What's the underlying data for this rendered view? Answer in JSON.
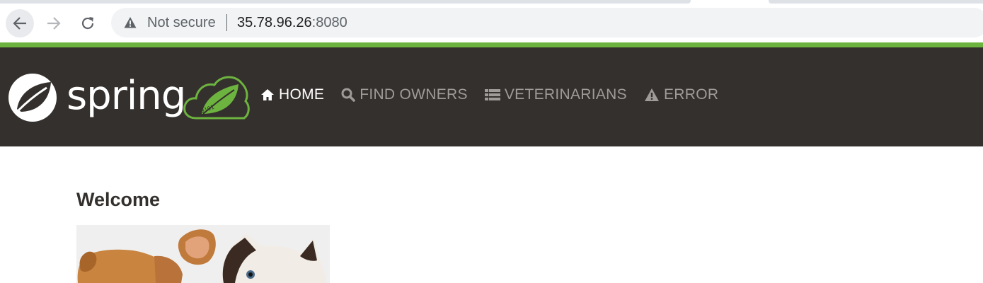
{
  "browser": {
    "security_label": "Not secure",
    "url_host": "35.78.96.26",
    "url_port": ":8080"
  },
  "navbar": {
    "brand": "spring",
    "items": [
      {
        "label": "HOME",
        "icon": "home-icon",
        "active": true
      },
      {
        "label": "FIND OWNERS",
        "icon": "search-icon",
        "active": false
      },
      {
        "label": "VETERINARIANS",
        "icon": "list-icon",
        "active": false
      },
      {
        "label": "ERROR",
        "icon": "warning-icon",
        "active": false
      }
    ]
  },
  "main": {
    "heading": "Welcome",
    "image": "pets-image"
  },
  "colors": {
    "spring_green": "#6db33f",
    "navbar_bg": "#34302d",
    "nav_inactive": "#9e9b98"
  }
}
